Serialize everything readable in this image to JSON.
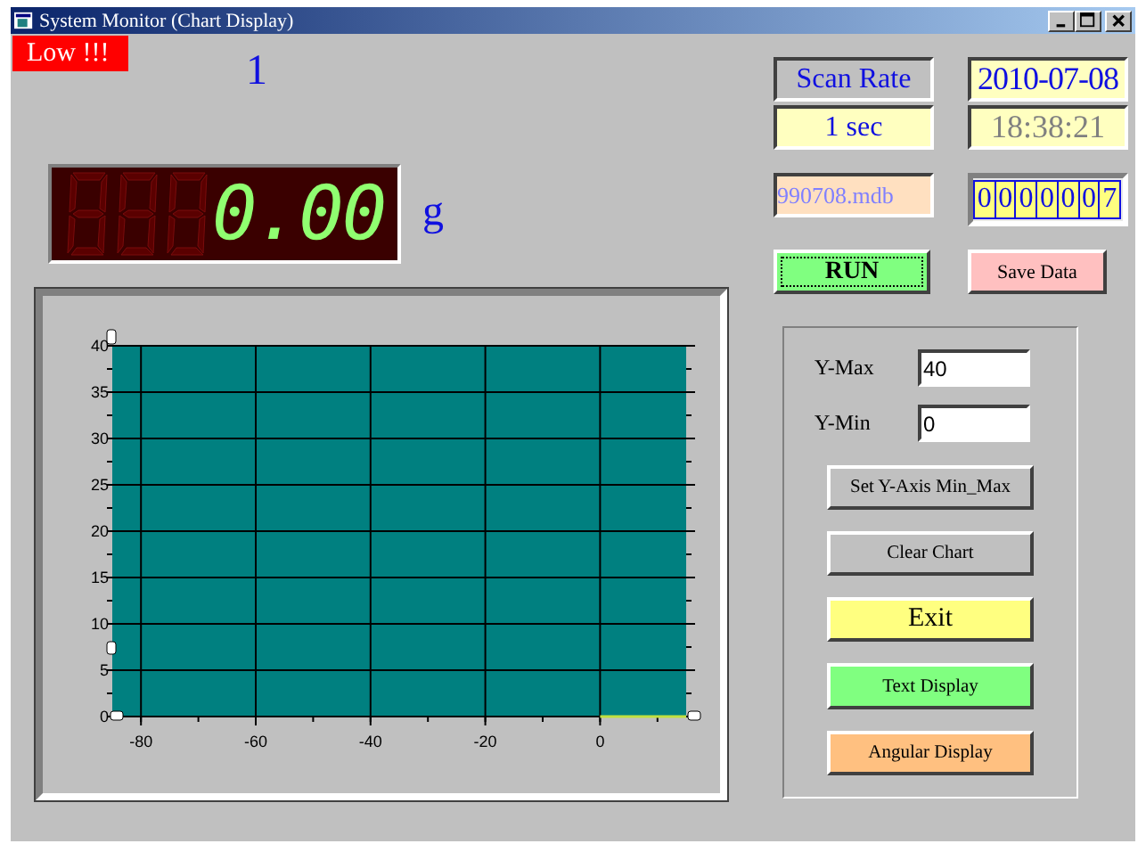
{
  "window": {
    "title": "System Monitor (Chart Display)"
  },
  "alarm": {
    "text": "Low !!!",
    "active": true
  },
  "channel": "1",
  "readout": {
    "value": "0.00",
    "unit": "g"
  },
  "scan_rate": {
    "label": "Scan Rate",
    "value": "1 sec"
  },
  "date": "2010-07-08",
  "time": "18:38:21",
  "file": "990708.mdb",
  "counter": [
    "0",
    "0",
    "0",
    "0",
    "0",
    "0",
    "7"
  ],
  "run_button": {
    "label": "RUN",
    "color": "#80ff80"
  },
  "save_button": {
    "label": "Save Data",
    "color": "#ffc0c0"
  },
  "chart": {
    "chart_data": {
      "type": "line",
      "xlim": [
        -85,
        15
      ],
      "ylim": [
        0,
        40
      ],
      "xticks": [
        -80,
        -60,
        -40,
        -20,
        0
      ],
      "yticks": [
        0,
        5,
        10,
        15,
        20,
        25,
        30,
        35,
        40
      ],
      "x": [
        0,
        15
      ],
      "grid": true,
      "series": [
        {
          "color": "#c0e040",
          "values": [
            0,
            0
          ]
        }
      ]
    }
  },
  "y_max": {
    "label": "Y-Max",
    "value": "40"
  },
  "y_min": {
    "label": "Y-Min",
    "value": "0"
  },
  "panel_buttons": [
    {
      "label": "Set Y-Axis Min_Max",
      "color": "#c0c0c0"
    },
    {
      "label": "Clear Chart",
      "color": "#c0c0c0"
    },
    {
      "label": "Exit",
      "color": "#ffff80"
    },
    {
      "label": "Text Display",
      "color": "#80ff80"
    },
    {
      "label": "Angular Display",
      "color": "#ffc080"
    }
  ]
}
